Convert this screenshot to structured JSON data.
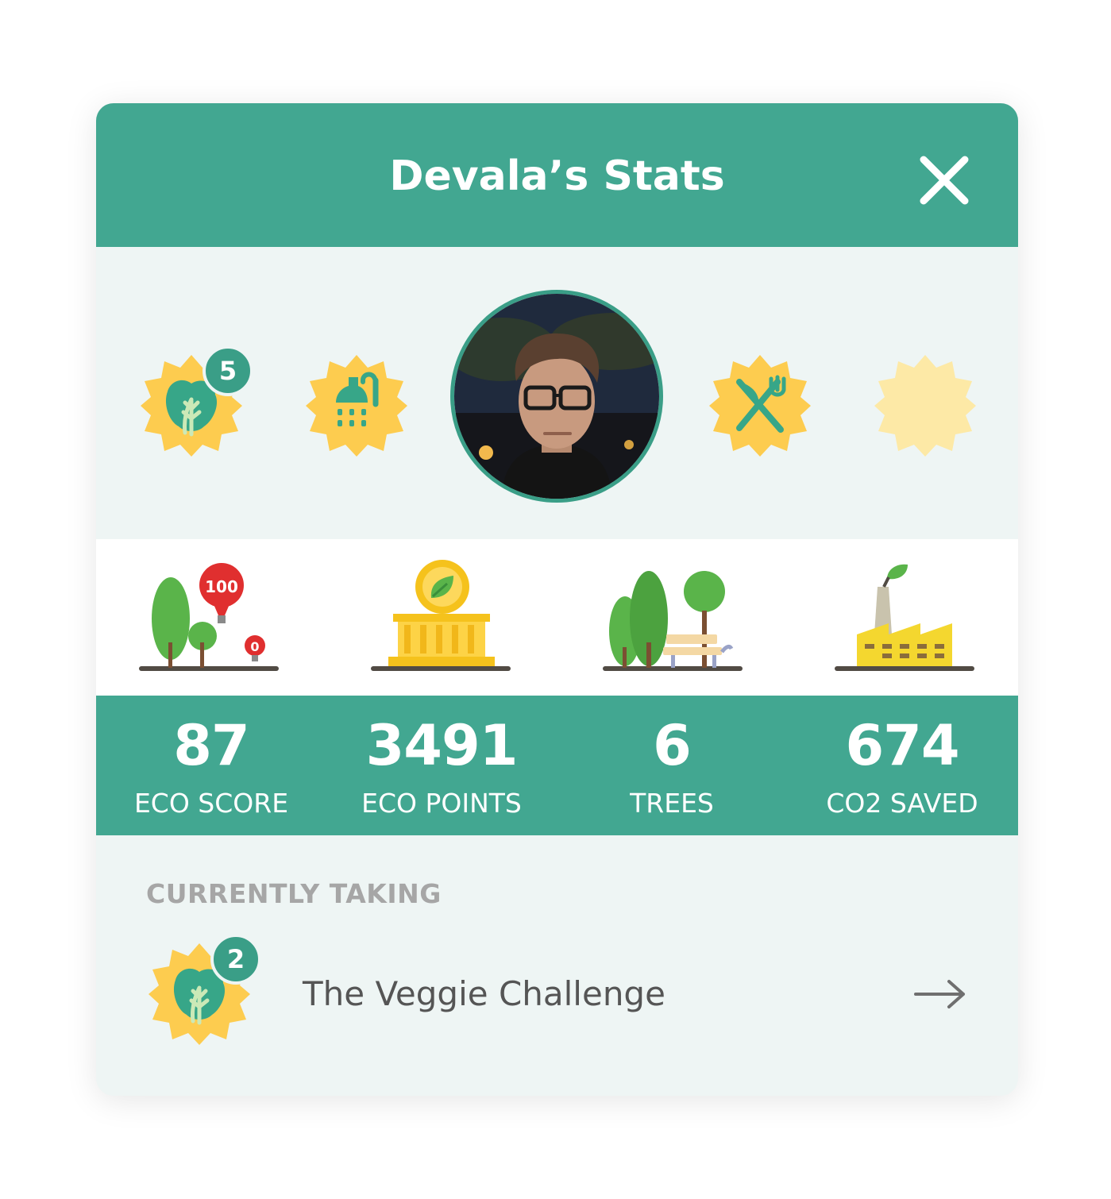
{
  "header": {
    "title": "Devala’s Stats"
  },
  "profile": {
    "badges_left": [
      {
        "icon": "lettuce-badge-icon",
        "count": "5",
        "state": "earned"
      },
      {
        "icon": "shower-badge-icon",
        "state": "earned"
      }
    ],
    "badges_right": [
      {
        "icon": "utensils-badge-icon",
        "state": "earned"
      },
      {
        "icon": "empty-badge-icon",
        "state": "locked"
      }
    ]
  },
  "stats": [
    {
      "value": "87",
      "label": "ECO SCORE",
      "icon": "trees-balloons-icon",
      "balloon_labels": [
        "100",
        "0"
      ]
    },
    {
      "value": "3491",
      "label": "ECO POINTS",
      "icon": "bank-coin-icon"
    },
    {
      "value": "6",
      "label": "TREES",
      "icon": "park-bench-icon"
    },
    {
      "value": "674",
      "label": "CO2 SAVED",
      "icon": "factory-icon"
    }
  ],
  "current": {
    "label": "CURRENTLY TAKING",
    "challenge": {
      "name": "The Veggie Challenge",
      "count": "2",
      "icon": "lettuce-badge-icon"
    }
  },
  "colors": {
    "primary": "#42a791",
    "badge_yellow": "#fdcc4f",
    "badge_locked": "#fde9a6",
    "background": "#eef5f4",
    "balloon_red": "#e02f2f"
  }
}
